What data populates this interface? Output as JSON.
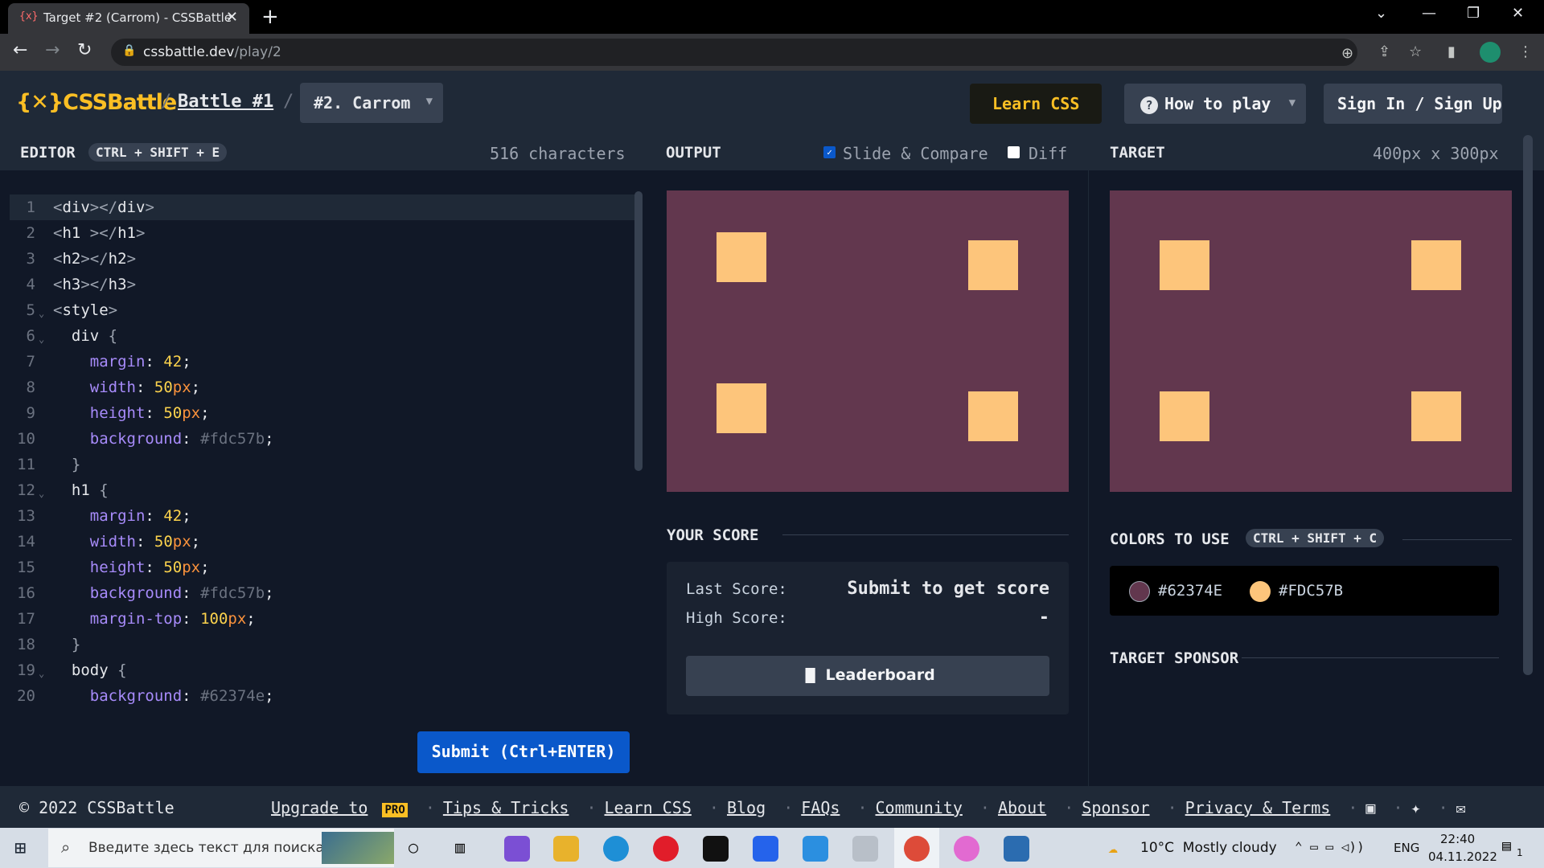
{
  "browser": {
    "tab_title": "Target #2 (Carrom) - CSSBattle",
    "tab_favicon": "{x}",
    "url_host": "cssbattle.dev",
    "url_path": "/play/2"
  },
  "header": {
    "logo": "{✕}CSSBattle",
    "battle": "Battle #1",
    "level": "#2. Carrom",
    "learn_css": "Learn CSS",
    "how_to_play": "How to play",
    "sign_in": "Sign In / Sign Up"
  },
  "editor": {
    "title": "EDITOR",
    "shortcut": "CTRL + SHIFT + E",
    "characters": "516 characters",
    "submit": "Submit (Ctrl+ENTER)"
  },
  "output": {
    "title": "OUTPUT",
    "slide_compare": "Slide & Compare",
    "diff": "Diff",
    "your_score": "YOUR SCORE",
    "last_score_label": "Last Score:",
    "last_score_value": "Submit to get score",
    "high_score_label": "High Score:",
    "high_score_value": "-",
    "leaderboard": "Leaderboard"
  },
  "target": {
    "title": "TARGET",
    "size": "400px x 300px",
    "colors_title": "COLORS TO USE",
    "colors_shortcut": "CTRL + SHIFT + C",
    "color1": "#62374E",
    "color2": "#FDC57B",
    "sponsor": "TARGET SPONSOR"
  },
  "colors": {
    "bg": "#62374e",
    "fg": "#fdc57b",
    "accent": "#0a58ca"
  },
  "footer": {
    "copyright": "© 2022 CSSBattle",
    "upgrade": "Upgrade to",
    "pro": "PRO",
    "links": [
      "Tips & Tricks",
      "Learn CSS",
      "Blog",
      "FAQs",
      "Community",
      "About",
      "Sponsor",
      "Privacy & Terms"
    ]
  },
  "taskbar": {
    "search_placeholder": "Введите здесь текст для поиска",
    "weather": "10°C  Mostly cloudy",
    "lang": "ENG",
    "time": "22:40",
    "date": "04.11.2022",
    "notifications": "1"
  }
}
